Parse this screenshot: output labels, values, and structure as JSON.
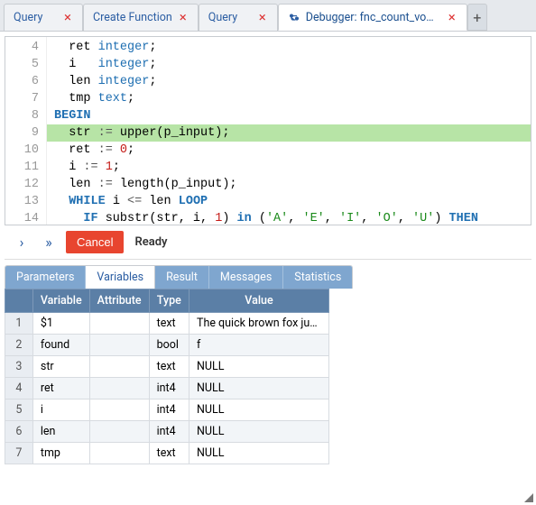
{
  "tabs": [
    {
      "label": "Query",
      "icon": null,
      "active": false
    },
    {
      "label": "Create Function",
      "icon": null,
      "active": false
    },
    {
      "label": "Query",
      "icon": null,
      "active": false
    },
    {
      "label": "Debugger: fnc_count_vowels",
      "icon": "share-icon",
      "active": true
    }
  ],
  "tab_close_glyph": "×",
  "tab_add_glyph": "+",
  "editor": {
    "first_line": 4,
    "highlight_line": 9,
    "lines": [
      {
        "n": 4,
        "raw": "  ret integer;"
      },
      {
        "n": 5,
        "raw": "  i   integer;"
      },
      {
        "n": 6,
        "raw": "  len integer;"
      },
      {
        "n": 7,
        "raw": "  tmp text;"
      },
      {
        "n": 8,
        "raw": "BEGIN"
      },
      {
        "n": 9,
        "raw": "  str := upper(p_input);"
      },
      {
        "n": 10,
        "raw": "  ret := 0;"
      },
      {
        "n": 11,
        "raw": "  i := 1;"
      },
      {
        "n": 12,
        "raw": "  len := length(p_input);"
      },
      {
        "n": 13,
        "raw": "  WHILE i <= len LOOP"
      },
      {
        "n": 14,
        "raw": "    IF substr(str, i, 1) in ('A', 'E', 'I', 'O', 'U') THEN"
      }
    ]
  },
  "toolbar": {
    "step_over_glyph": "›",
    "step_into_glyph": "»",
    "cancel_label": "Cancel",
    "status": "Ready"
  },
  "panel_tabs": [
    {
      "key": "parameters",
      "label": "Parameters",
      "active": false
    },
    {
      "key": "variables",
      "label": "Variables",
      "active": true
    },
    {
      "key": "result",
      "label": "Result",
      "active": false
    },
    {
      "key": "messages",
      "label": "Messages",
      "active": false
    },
    {
      "key": "statistics",
      "label": "Statistics",
      "active": false
    }
  ],
  "var_table": {
    "headers": {
      "rownum": "",
      "variable": "Variable",
      "attribute": "Attribute",
      "type": "Type",
      "value": "Value"
    },
    "rows": [
      {
        "n": "1",
        "variable": "$1",
        "attribute": "",
        "type": "text",
        "value": "The quick brown fox jumps o…"
      },
      {
        "n": "2",
        "variable": "found",
        "attribute": "",
        "type": "bool",
        "value": "f"
      },
      {
        "n": "3",
        "variable": "str",
        "attribute": "",
        "type": "text",
        "value": "NULL"
      },
      {
        "n": "4",
        "variable": "ret",
        "attribute": "",
        "type": "int4",
        "value": "NULL"
      },
      {
        "n": "5",
        "variable": "i",
        "attribute": "",
        "type": "int4",
        "value": "NULL"
      },
      {
        "n": "6",
        "variable": "len",
        "attribute": "",
        "type": "int4",
        "value": "NULL"
      },
      {
        "n": "7",
        "variable": "tmp",
        "attribute": "",
        "type": "text",
        "value": "NULL"
      }
    ]
  }
}
